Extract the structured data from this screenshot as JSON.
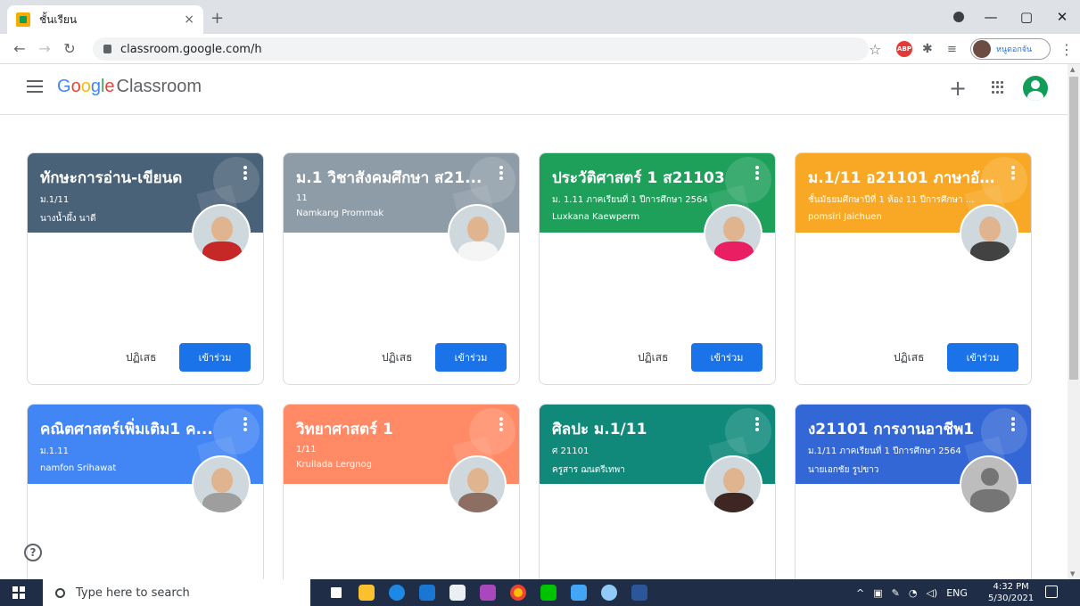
{
  "browser": {
    "tab_title": "ชั้นเรียน",
    "tab_close": "×",
    "new_tab": "+",
    "url": "classroom.google.com/h",
    "profile_name": "หนูดอกจัน",
    "win_min": "—",
    "win_max": "▢",
    "win_close": "✕"
  },
  "app": {
    "brand_google": [
      "G",
      "o",
      "o",
      "g",
      "l",
      "e"
    ],
    "brand_product": "Classroom",
    "plus": "+"
  },
  "classes": [
    {
      "title": "ทักษะการอ่าน-เขียนด",
      "section": "ม.1/11",
      "teacher": "นางน้ำผึ้ง นาดี",
      "color": "#4a6278",
      "avatar_body": "#c62828",
      "decline": "ปฏิเสธ",
      "join": "เข้าร่วม"
    },
    {
      "title": "ม.1 วิชาสังคมศึกษา ส21...",
      "section": "11",
      "teacher": "Namkang Prommak",
      "color": "#8e9ca7",
      "avatar_body": "#f5f5f5",
      "decline": "ปฏิเสธ",
      "join": "เข้าร่วม"
    },
    {
      "title": "ประวัติศาสตร์ 1 ส21103",
      "section": "ม. 1.11 ภาคเรียนที่ 1 ปีการศึกษา 2564",
      "teacher": "Luxkana Kaewperm",
      "color": "#1e9f5a",
      "avatar_body": "#e91e63",
      "decline": "ปฏิเสธ",
      "join": "เข้าร่วม"
    },
    {
      "title": "ม.1/11 อ21101 ภาษาอังก...",
      "section": "ชั้นมัธยมศึกษาปีที่ 1 ห้อง 11 ปีการศึกษา ...",
      "teacher": "pomsiri Jaichuen",
      "color": "#f8a825",
      "avatar_body": "#424242",
      "decline": "ปฏิเสธ",
      "join": "เข้าร่วม"
    },
    {
      "title": "คณิตศาสตร์เพิ่มเติม1 ค...",
      "section": "ม.1.11",
      "teacher": "namfon Srihawat",
      "color": "#4285f4",
      "avatar_body": "#9e9e9e"
    },
    {
      "title": "วิทยาศาสตร์ 1",
      "section": "1/11",
      "teacher": "Kruilada Lergnog",
      "color": "#ff8a65",
      "avatar_body": "#8d6e63"
    },
    {
      "title": "ศิลปะ ม.1/11",
      "section": "ศ 21101",
      "teacher": "ครูสาร ฌนตรีเทพา",
      "color": "#10897b",
      "avatar_body": "#3e2723"
    },
    {
      "title": "ง21101 การงานอาชีพ1",
      "section": "ม.1/11 ภาคเรียนที่ 1 ปีการศึกษา 2564",
      "teacher": "นายเอกชัย รูปขาว",
      "color": "#3367d6",
      "avatar_body": "#757575",
      "placeholder": true
    }
  ],
  "help": "?",
  "taskbar": {
    "search_placeholder": "Type here to search",
    "lang": "ENG",
    "time": "4:32 PM",
    "date": "5/30/2021"
  }
}
